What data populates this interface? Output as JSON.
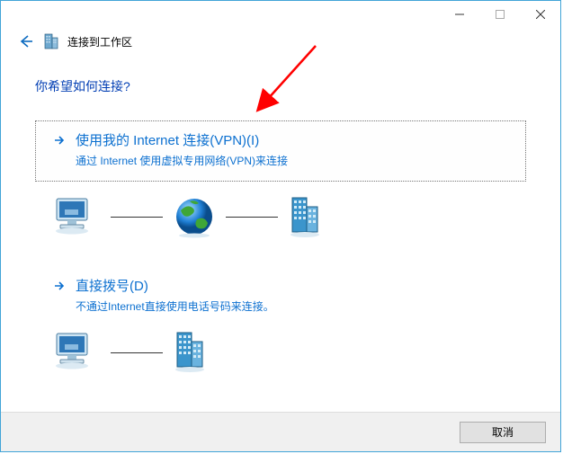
{
  "window": {
    "title": "连接到工作区"
  },
  "page": {
    "question": "你希望如何连接?"
  },
  "option1": {
    "title": "使用我的 Internet 连接(VPN)(I)",
    "desc": "通过 Internet 使用虚拟专用网络(VPN)来连接"
  },
  "option2": {
    "title": "直接拨号(D)",
    "desc": "不通过Internet直接使用电话号码来连接。"
  },
  "footer": {
    "cancel": "取消"
  },
  "icons": {
    "back": "back-arrow",
    "building": "building-icon",
    "arrow_right": "arrow-right",
    "computer": "computer-icon",
    "globe": "globe-icon",
    "server": "server-icon",
    "minimize": "minimize-icon",
    "maximize": "maximize-icon",
    "close": "close-icon"
  }
}
